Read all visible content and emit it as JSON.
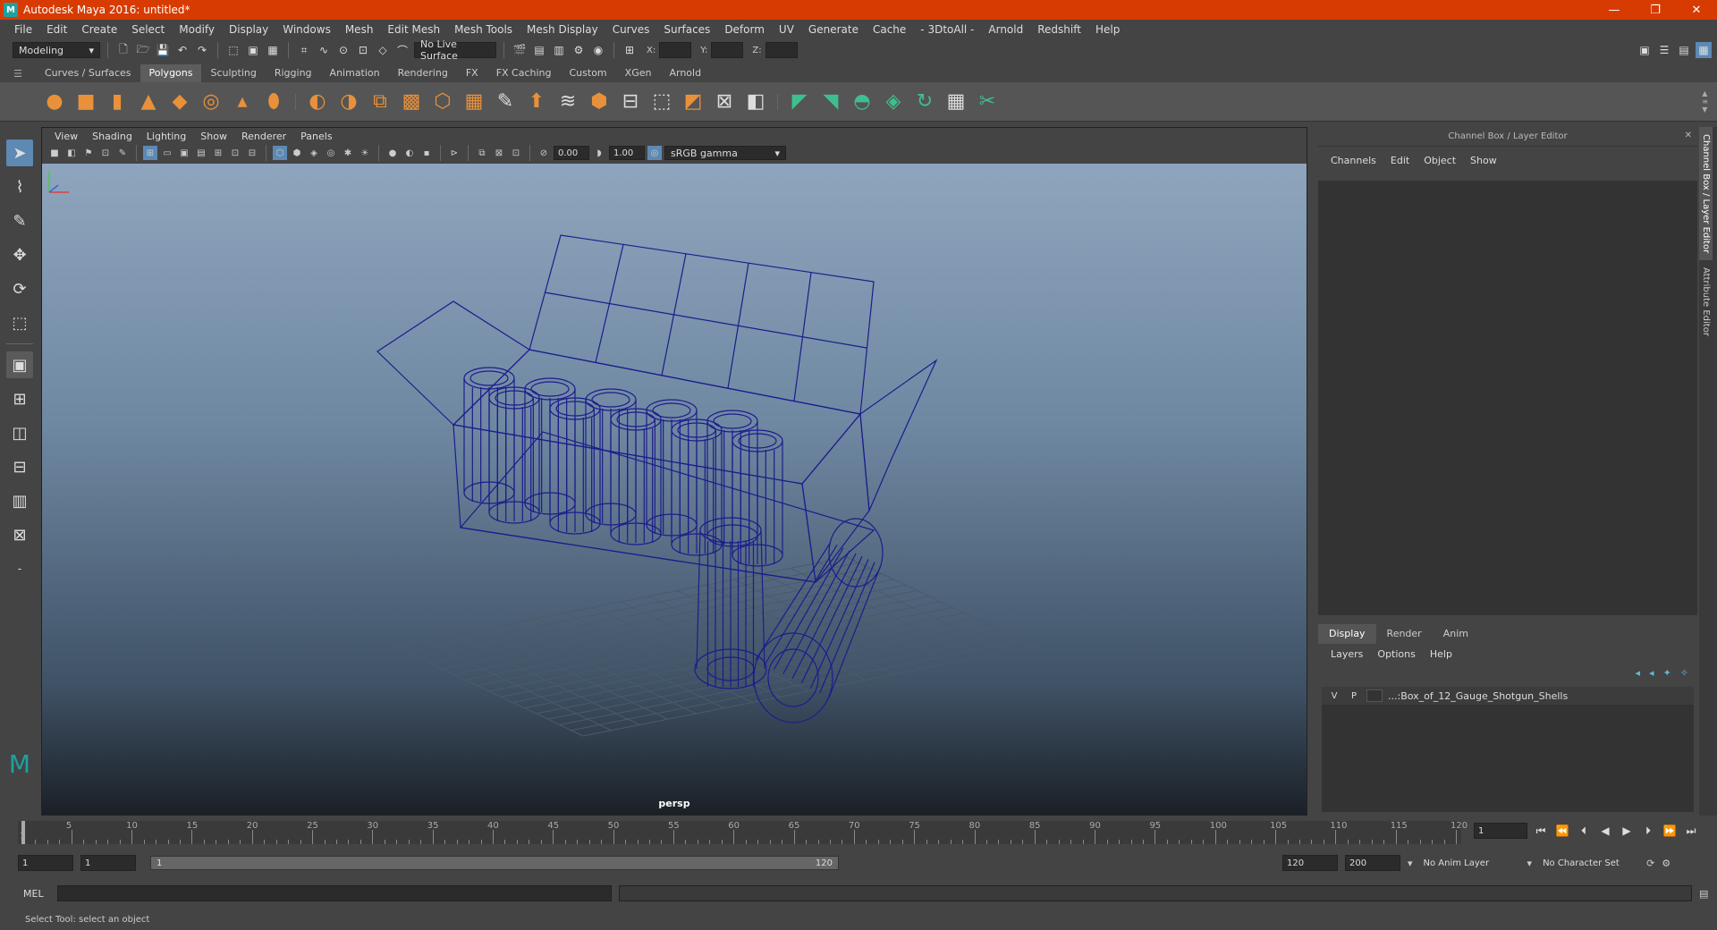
{
  "window": {
    "title": "Autodesk Maya 2016: untitled*",
    "icon_label": "M",
    "controls": [
      "—",
      "❐",
      "✕"
    ]
  },
  "menubar": [
    "File",
    "Edit",
    "Create",
    "Select",
    "Modify",
    "Display",
    "Windows",
    "Mesh",
    "Edit Mesh",
    "Mesh Tools",
    "Mesh Display",
    "Curves",
    "Surfaces",
    "Deform",
    "UV",
    "Generate",
    "Cache",
    "- 3DtoAll -",
    "Arnold",
    "Redshift",
    "Help"
  ],
  "statusline": {
    "menuset": "Modeling",
    "live_surface": "No Live Surface",
    "x_label": "X:",
    "y_label": "Y:",
    "z_label": "Z:"
  },
  "shelf": {
    "tabs": [
      "Curves / Surfaces",
      "Polygons",
      "Sculpting",
      "Rigging",
      "Animation",
      "Rendering",
      "FX",
      "FX Caching",
      "Custom",
      "XGen",
      "Arnold"
    ],
    "active_tab": "Polygons"
  },
  "viewport": {
    "menu": [
      "View",
      "Shading",
      "Lighting",
      "Show",
      "Renderer",
      "Panels"
    ],
    "exposure": "0.00",
    "gamma": "1.00",
    "color_space": "sRGB gamma",
    "camera": "persp"
  },
  "channelbox": {
    "header": "Channel Box / Layer Editor",
    "menu": [
      "Channels",
      "Edit",
      "Object",
      "Show"
    ],
    "layer_tabs": [
      "Display",
      "Render",
      "Anim"
    ],
    "active_layer_tab": "Display",
    "layer_menu": [
      "Layers",
      "Options",
      "Help"
    ],
    "layer": {
      "visible": "V",
      "playback": "P",
      "name": "...:Box_of_12_Gauge_Shotgun_Shells"
    }
  },
  "sidetabs": [
    "Channel Box / Layer Editor",
    "Attribute Editor"
  ],
  "timeline": {
    "ticks": [
      5,
      10,
      15,
      20,
      25,
      30,
      35,
      40,
      45,
      50,
      55,
      60,
      65,
      70,
      75,
      80,
      85,
      90,
      95,
      100,
      105,
      110,
      115,
      120
    ],
    "start_label": "1",
    "current_frame": "1",
    "min": 1,
    "max": 120
  },
  "range": {
    "start": "1",
    "playback_start": "1",
    "bar_start": "1",
    "bar_end": "120",
    "playback_end": "120",
    "end": "200",
    "anim_layer": "No Anim Layer",
    "character_set": "No Character Set"
  },
  "cmdline": {
    "label": "MEL"
  },
  "helpline": "Select Tool: select an object",
  "colors": {
    "titlebar": "#d83b01",
    "wireframe": "#1c1c8c",
    "active_tool": "#5d89b3"
  }
}
